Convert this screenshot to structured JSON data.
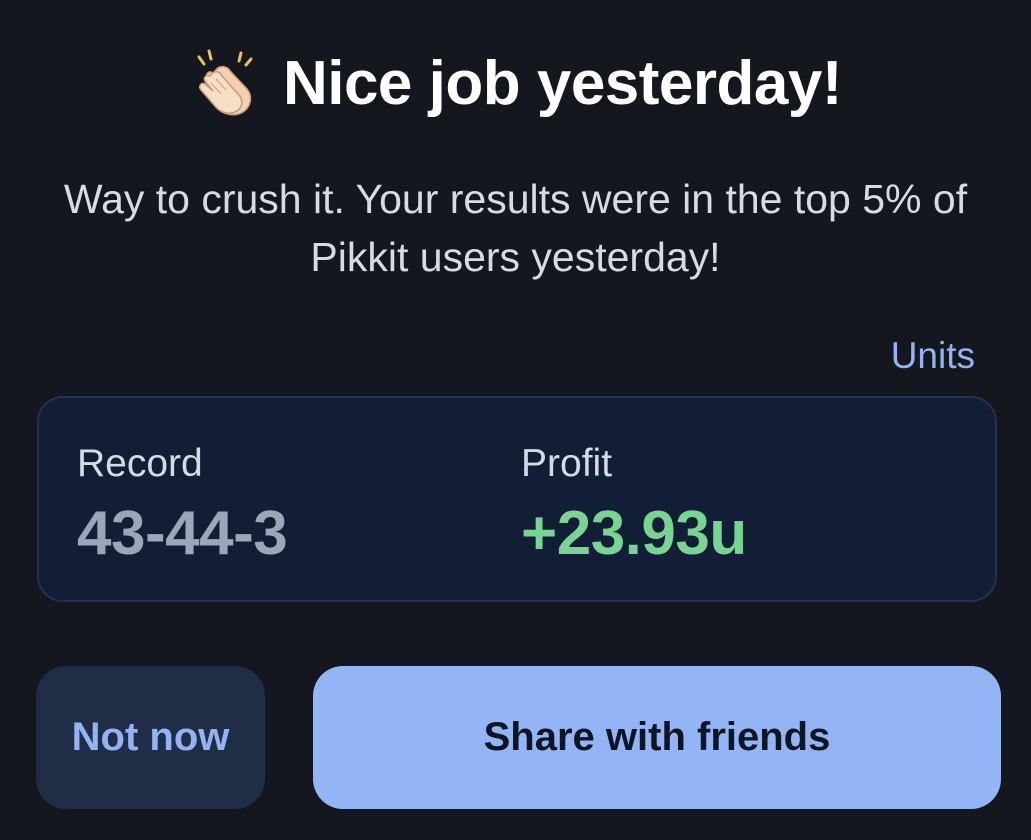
{
  "header": {
    "title": "Nice job yesterday!",
    "title_icon": "clapping-hands-icon"
  },
  "message": {
    "text": "Way to crush it. Your results were in the top 5% of Pikkit users yesterday!"
  },
  "units_toggle": {
    "label": "Units"
  },
  "stats": {
    "record": {
      "label": "Record",
      "value": "43-44-3"
    },
    "profit": {
      "label": "Profit",
      "value": "+23.93u"
    }
  },
  "actions": {
    "not_now_label": "Not now",
    "share_label": "Share with friends"
  },
  "colors": {
    "background": "#14171d",
    "accent": "#94b3f4",
    "profit_positive": "#79d391",
    "card_background": "#121e35"
  }
}
